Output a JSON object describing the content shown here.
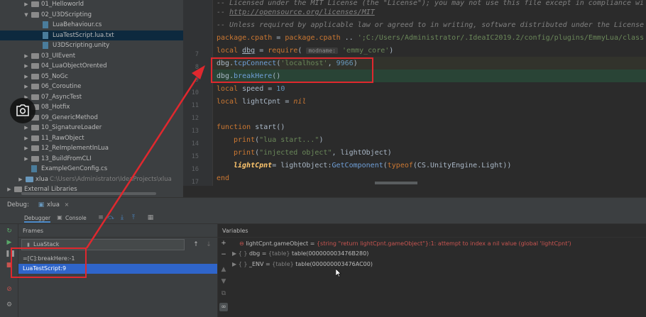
{
  "tree": {
    "items": [
      {
        "label": "01_Helloworld",
        "type": "folder",
        "depth": 3,
        "arrow": "▶"
      },
      {
        "label": "02_U3DScripting",
        "type": "folder",
        "depth": 3,
        "arrow": "▼"
      },
      {
        "label": "LuaBehaviour.cs",
        "type": "file",
        "depth": 5,
        "arrow": ""
      },
      {
        "label": "LuaTestScript.lua.txt",
        "type": "file",
        "depth": 5,
        "arrow": "",
        "selected": true
      },
      {
        "label": "U3DScripting.unity",
        "type": "file",
        "depth": 5,
        "arrow": ""
      },
      {
        "label": "03_UIEvent",
        "type": "folder",
        "depth": 3,
        "arrow": "▶"
      },
      {
        "label": "04_LuaObjectOrented",
        "type": "folder",
        "depth": 3,
        "arrow": "▶"
      },
      {
        "label": "05_NoGc",
        "type": "folder",
        "depth": 3,
        "arrow": "▶"
      },
      {
        "label": "06_Coroutine",
        "type": "folder",
        "depth": 3,
        "arrow": "▶"
      },
      {
        "label": "07_AsyncTest",
        "type": "folder",
        "depth": 3,
        "arrow": "▶"
      },
      {
        "label": "08_Hotfix",
        "type": "folder",
        "depth": 3,
        "arrow": "▶"
      },
      {
        "label": "09_GenericMethod",
        "type": "folder",
        "depth": 3,
        "arrow": "▶"
      },
      {
        "label": "10_SignatureLoader",
        "type": "folder",
        "depth": 3,
        "arrow": "▶"
      },
      {
        "label": "11_RawObject",
        "type": "folder",
        "depth": 3,
        "arrow": "▶"
      },
      {
        "label": "12_ReImplementInLua",
        "type": "folder",
        "depth": 3,
        "arrow": "▶"
      },
      {
        "label": "13_BuildFromCLI",
        "type": "folder",
        "depth": 3,
        "arrow": "▶"
      },
      {
        "label": "ExampleGenConfig.cs",
        "type": "file",
        "depth": 3,
        "arrow": ""
      },
      {
        "label": "xlua",
        "suffix": "C:\\Users\\Administrator\\IdeaProjects\\xlua",
        "type": "folder-blue",
        "depth": 2,
        "arrow": "▶"
      },
      {
        "label": "External Libraries",
        "type": "folder-lib",
        "depth": 0,
        "arrow": "▶"
      }
    ]
  },
  "editor": {
    "line_numbers": [
      "",
      "",
      "",
      "",
      "7",
      "8",
      "9",
      "10",
      "11",
      "12",
      "13",
      "14",
      "15",
      "16",
      "17"
    ]
  },
  "code": {
    "l1": "-- Licensed under the MIT License (the \"License\"); you may not use this file except in compliance wi",
    "l2": "http://opensource.org/licenses/MIT",
    "l2pre": "-- ",
    "l3": "-- Unless required by applicable law or agreed to in writing, software distributed under the License",
    "l4a": "package.cpath",
    "l4b": " = ",
    "l4c": "package.cpath",
    "l4d": " .. ",
    "l4e": "';C:/Users/Administrator/.IdeaIC2019.2/config/plugins/EmmyLua/class",
    "l5a": "local ",
    "l5b": "dbg",
    "l5c": " = ",
    "l5d": "require",
    "l5e": "(",
    "l5hint": "modname:",
    "l5f": "'emmy_core'",
    "l5g": ")",
    "l6a": "dbg",
    "l6b": ".",
    "l6c": "tcpConnect",
    "l6d": "(",
    "l6e": "'localhost'",
    "l6f": ", ",
    "l6g": "9966",
    "l6h": ")",
    "l7a": "dbg",
    "l7b": ".",
    "l7c": "breakHere",
    "l7d": "()",
    "l8a": "local ",
    "l8b": "speed",
    "l8c": " = ",
    "l8d": "10",
    "l9a": "local ",
    "l9b": "lightCpnt",
    "l9c": " = ",
    "l9d": "nil",
    "l11a": "function ",
    "l11b": "start",
    "l11c": "()",
    "l12a": "print",
    "l12b": "(",
    "l12c": "\"lua start...\"",
    "l12d": ")",
    "l13a": "print",
    "l13b": "(",
    "l13c": "\"injected object\"",
    "l13d": ", lightObject)",
    "l14a": "lightCpnt",
    "l14b": "= lightObject:",
    "l14c": "GetComponent",
    "l14d": "(",
    "l14e": "typeof",
    "l14f": "(CS.UnityEngine.Light))",
    "l15": "end"
  },
  "debug": {
    "title": "Debug:",
    "config": "xlua",
    "tabs": [
      "Debugger",
      "Console"
    ],
    "frames_label": "Frames",
    "variables_label": "Variables",
    "thread": "LuaStack",
    "frames": [
      "=[C]:breakHere:-1",
      "LuaTestScript:9"
    ],
    "variables": {
      "error_name": "lightCpnt.gameObject",
      "error_eq": " = ",
      "error_value": "{string \"return lightCpnt.gameObject\"}:1: attempt to index a nil value (global 'lightCpnt')",
      "dbg_name": "dbg",
      "dbg_type": "{table}",
      "dbg_value": "table(000000003476B280)",
      "env_name": "_ENV",
      "env_type": "{table}",
      "env_value": "table(000000003476AC00)"
    }
  },
  "colors": {
    "highlight": "#e0282e",
    "selection": "#2f65ca"
  }
}
